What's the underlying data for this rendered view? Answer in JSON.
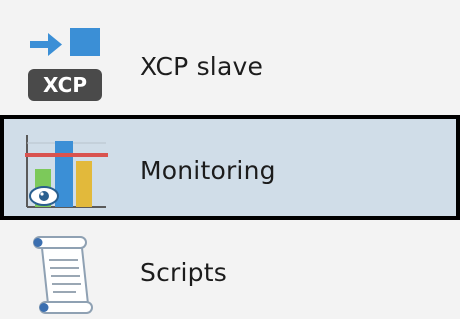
{
  "navigation": {
    "items": [
      {
        "label": "XCP slave",
        "icon": "xcp-slave-icon",
        "badge_text": "XCP",
        "selected": false
      },
      {
        "label": "Monitoring",
        "icon": "monitoring-chart-icon",
        "selected": true
      },
      {
        "label": "Scripts",
        "icon": "script-scroll-icon",
        "selected": false
      }
    ]
  },
  "colors": {
    "selected_background": "#d0dde8",
    "selected_border": "#000000",
    "panel_background": "#f3f3f3",
    "icon_blue": "#3b8fd6",
    "badge_gray": "#4a4a4a",
    "chart_green": "#7cc95a",
    "chart_yellow": "#e2b93b",
    "threshold_red": "#d9534f"
  }
}
